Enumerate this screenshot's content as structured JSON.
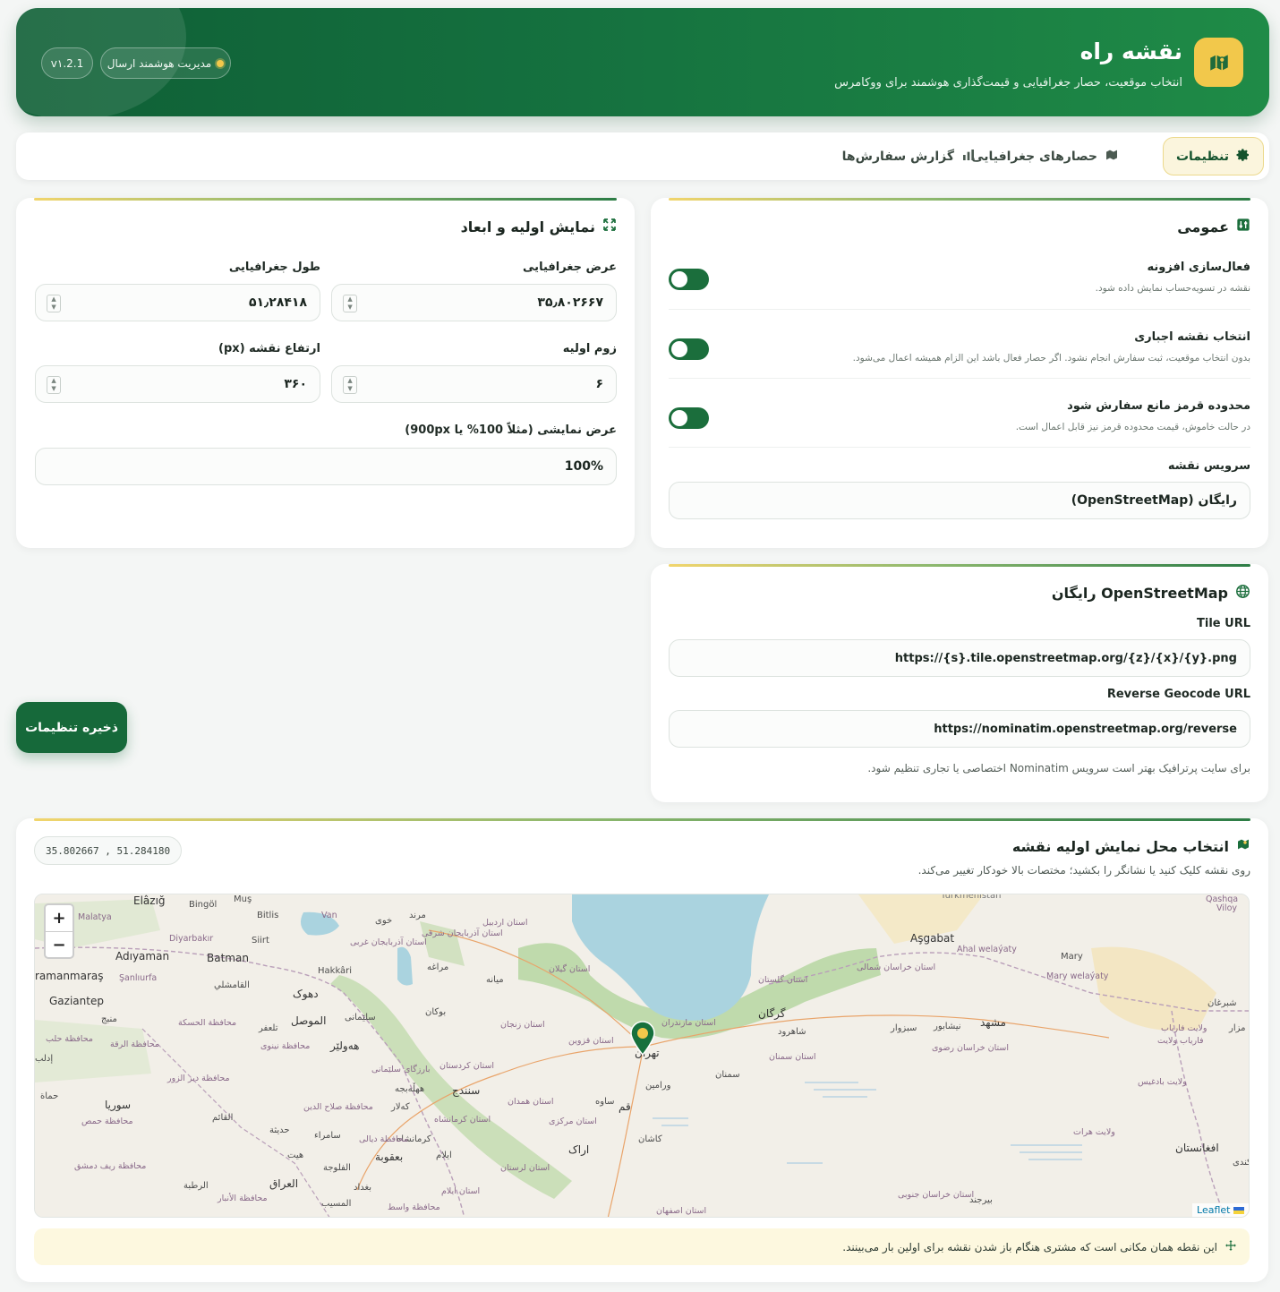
{
  "header": {
    "title": "نقشه راه",
    "subtitle": "انتخاب موقعیت، حصار جغرافیایی و قیمت‌گذاری هوشمند برای ووکامرس",
    "status_pill": "مدیریت هوشمند ارسال",
    "version": "v۱.2.1"
  },
  "tabs": [
    {
      "label": "تنظیمات",
      "icon": "gear-icon",
      "active": true
    },
    {
      "label": "حصارهای جغرافیایی",
      "icon": "map-icon",
      "active": false
    },
    {
      "label": "گزارش سفارش‌ها",
      "icon": "bar-chart-icon",
      "active": false
    }
  ],
  "general": {
    "title": "عمومی",
    "enable_plugin": {
      "label": "فعال‌سازی افزونه",
      "desc": "نقشه در تسویه‌حساب نمایش داده شود.",
      "on": true
    },
    "force_map": {
      "label": "انتخاب نقشه اجباری",
      "desc": "بدون انتخاب موقعیت، ثبت سفارش انجام نشود. اگر حصار فعال باشد این الزام همیشه اعمال می‌شود.",
      "on": true
    },
    "red_zone": {
      "label": "محدوده قرمز مانع سفارش شود",
      "desc": "در حالت خاموش، قیمت محدوده قرمز نیز قابل اعمال است.",
      "on": true
    },
    "map_service": {
      "label": "سرویس نقشه",
      "value": "رایگان (OpenStreetMap)"
    }
  },
  "display": {
    "title": "نمایش اولیه و ابعاد",
    "latitude": {
      "label": "عرض جغرافیایی",
      "value": "۳۵٫۸۰۲۶۶۷"
    },
    "longitude": {
      "label": "طول جغرافیایی",
      "value": "۵۱٫۲۸۴۱۸"
    },
    "zoom": {
      "label": "زوم اولیه",
      "value": "۶"
    },
    "height": {
      "label": "ارتفاع نقشه (px)",
      "value": "۳۶۰"
    },
    "width": {
      "label": "عرض نمایشی (مثلاً 100% یا 900px)",
      "value": "100%"
    }
  },
  "osm": {
    "title": "OpenStreetMap رایگان",
    "tile_label": "Tile URL",
    "tile_value": "https://{s}.tile.openstreetmap.org/{z}/{x}/{y}.png",
    "geocode_label": "Reverse Geocode URL",
    "geocode_value": "https://nominatim.openstreetmap.org/reverse",
    "hint": "برای سایت پرترافیک بهتر است سرویس Nominatim اختصاصی یا تجاری تنظیم شود."
  },
  "save_button": "ذخیره تنظیمات",
  "location": {
    "title": "انتخاب محل نمایش اولیه نقشه",
    "hint": "روی نقشه کلیک کنید یا نشانگر را بکشید؛ مختصات بالا خودکار تغییر می‌کند.",
    "coords": "35.802667 , 51.284180",
    "zoom_in": "+",
    "zoom_out": "−",
    "attribution": "Leaflet",
    "note": "این نقطه همان مکانی است که مشتری هنگام باز شدن نقشه برای اولین بار می‌بینند."
  },
  "map_labels": [
    "Elâzığ",
    "Muş",
    "Bingöl",
    "Bitlis",
    "Van",
    "Malatya",
    "Diyarbakır",
    "Siirt",
    "Adıyaman",
    "Batman",
    "ramanmaraş",
    "Şanlıurfa",
    "Hakkâri",
    "Gaziantep",
    "Turkmenistan",
    "Aşgabat",
    "Ahal welaýaty",
    "Mary",
    "Mary welaýaty",
    "Qashqa",
    "Viloy",
    "خوی",
    "مرند",
    "استان اردبیل",
    "استان آذربایجان شرقی",
    "استان آذربایجان غربی",
    "مراغه",
    "میانه",
    "استان گیلان",
    "بوکان",
    "استان زنجان",
    "استان قزوین",
    "استان مازندران",
    "استان گلستان",
    "گرگان",
    "شاهرود",
    "استان سمنان",
    "سمنان",
    "تهران",
    "ورامین",
    "قم",
    "ساوه",
    "استان مرکزی",
    "اراک",
    "کاشان",
    "استان اصفهان",
    "استان همدان",
    "سنندج",
    "استان کردستان",
    "استان کرمانشاه",
    "کرمانشاه",
    "استان لرستان",
    "استان ایلام",
    "ایلام",
    "دهوک",
    "الموصل",
    "هه‌ولێر",
    "القامشلي",
    "محافظة الحسكة",
    "منبج",
    "تلعفر",
    "محافظة نينوى",
    "بارزگای سلێمانی",
    "سلێمانی",
    "ههڵەبجە",
    "کەلار",
    "محافظة صلاح الدين",
    "سامراء",
    "بعقوبة",
    "محافظة ديالى",
    "القائم",
    "حديثة",
    "هيت",
    "الفلوجة",
    "بغداد",
    "العراق",
    "الرطبة",
    "محافظة الأنبار",
    "المسيب",
    "محافظة واسط",
    "سوريا",
    "محافظة حمص",
    "حماة",
    "إدلب",
    "محافظة حلب",
    "محافظة الرقة",
    "محافظة دير الزور",
    "محافظة ريف دمشق",
    "استان خراسان شمالی",
    "مشهد",
    "نیشابور",
    "سبزوار",
    "استان خراسان رضوی",
    "استان خراسان جنوبی",
    "بیرجند",
    "افغانستان",
    "شبرغان",
    "ولایت بادغیس",
    "ولایت هرات",
    "کندی",
    "مزار",
    "ولایت فاریاب",
    "فاریاب ولایت"
  ]
}
